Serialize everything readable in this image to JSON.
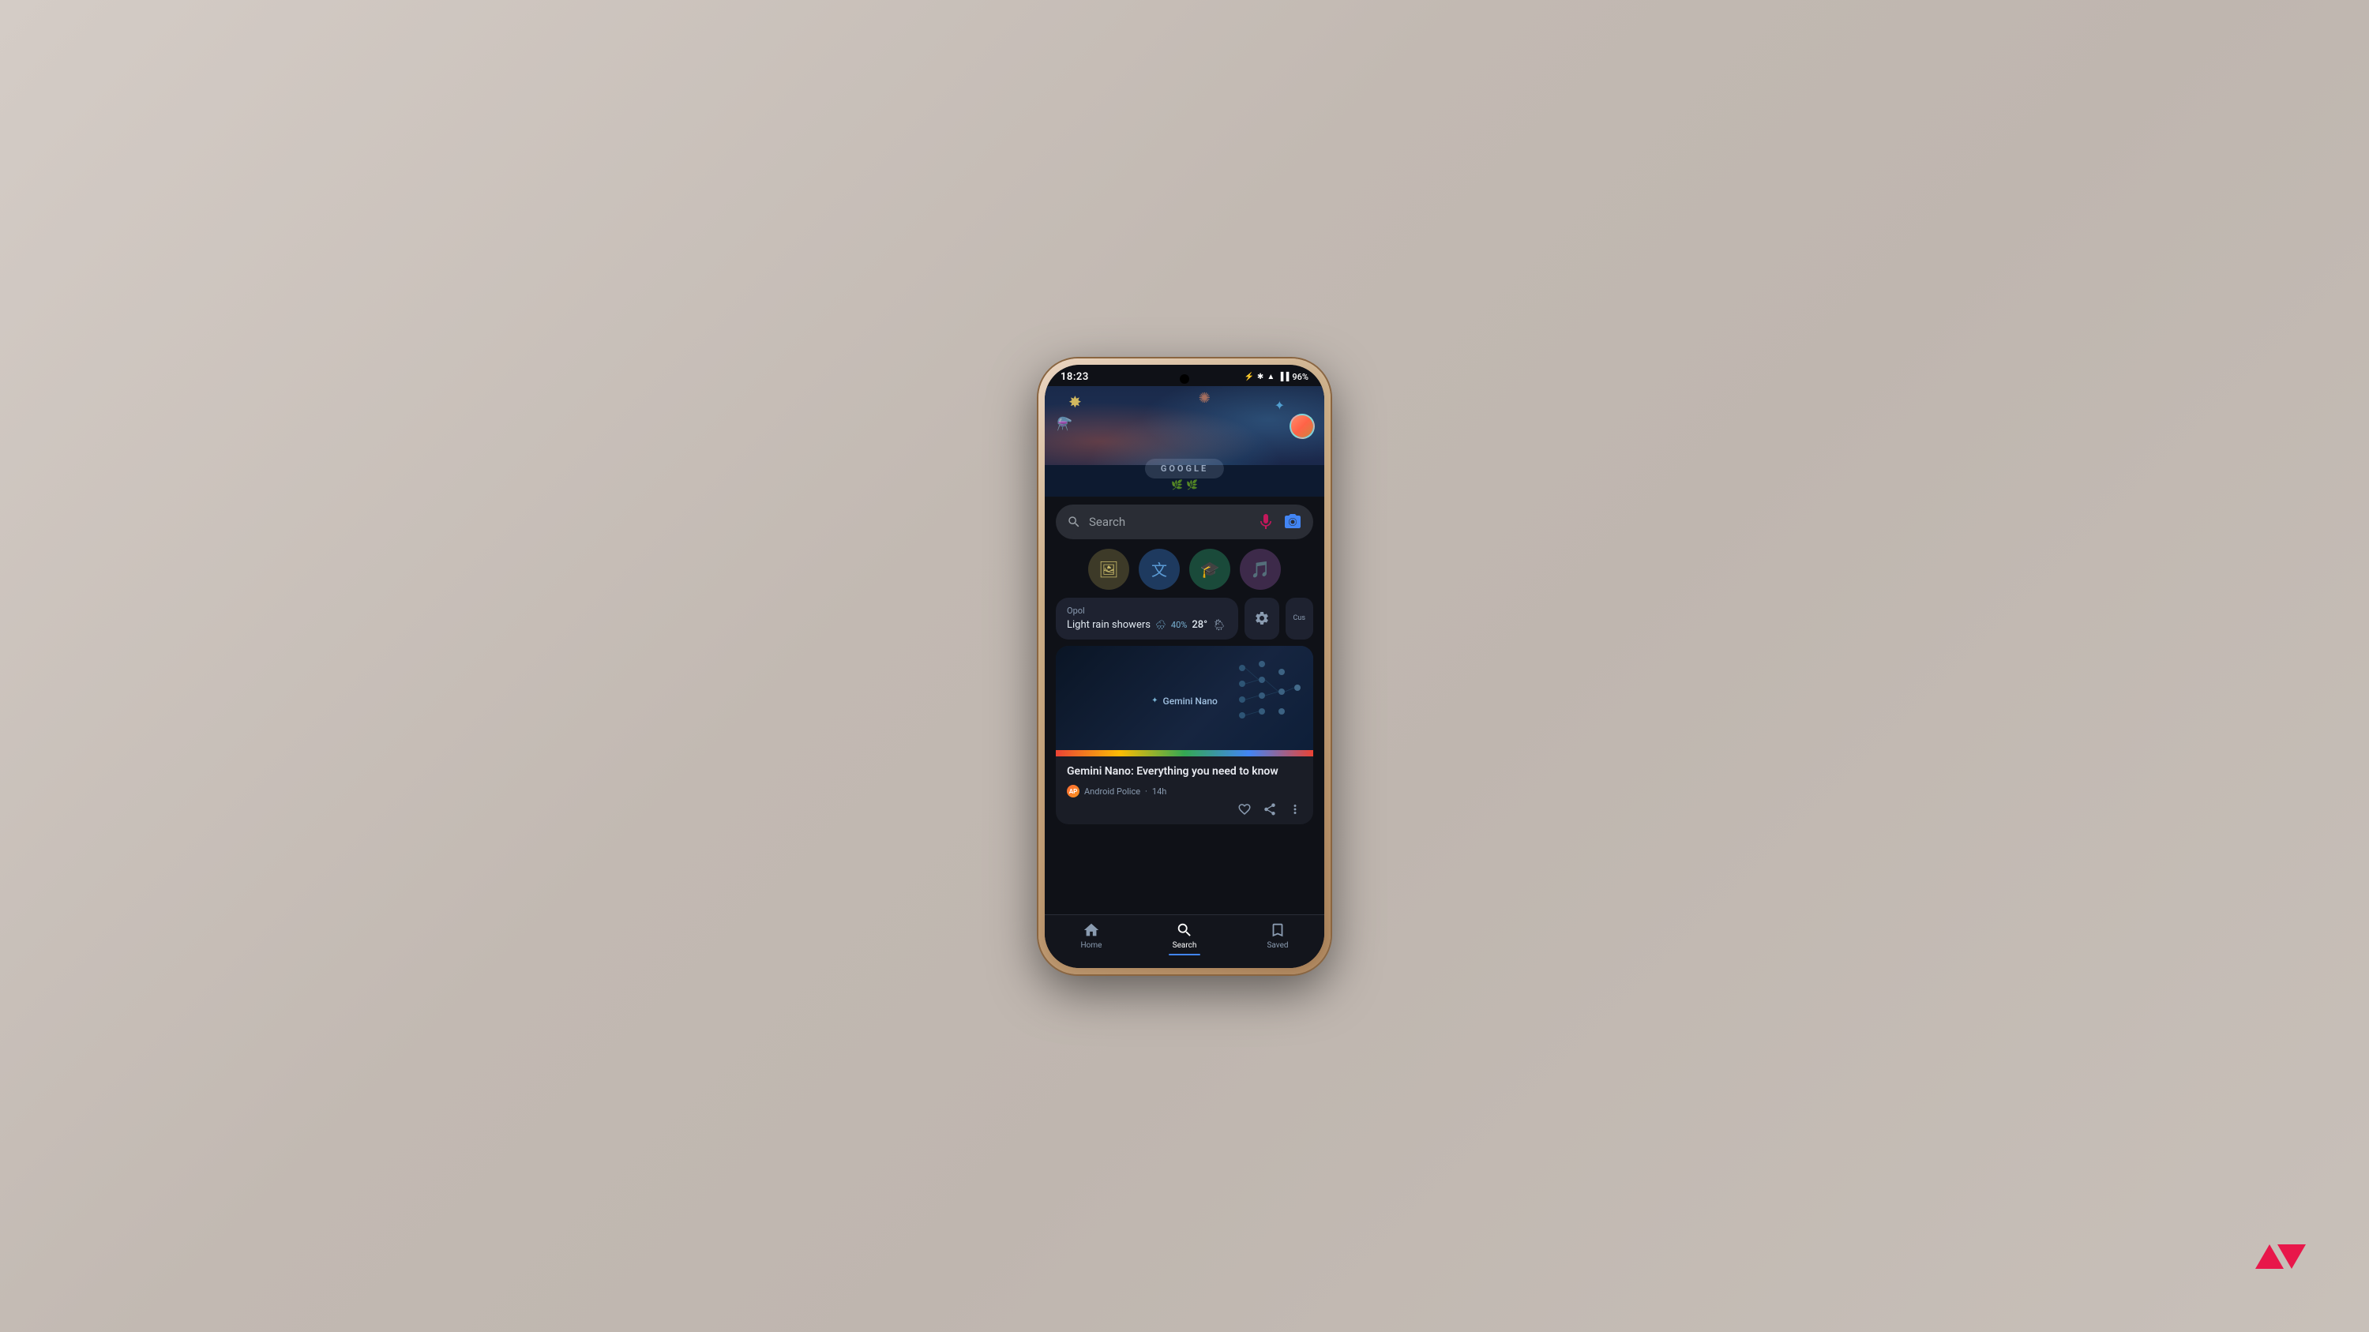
{
  "scene": {
    "bg_color": "#c2b8b0"
  },
  "status_bar": {
    "time": "18:23",
    "battery": "96%",
    "signal_icon": "signal",
    "wifi_icon": "wifi",
    "battery_icon": "battery"
  },
  "doodle": {
    "logo_text": "GOOGLE",
    "bg_label": "google-doodle-banner"
  },
  "search": {
    "placeholder": "Search",
    "mic_icon": "microphone-icon",
    "lens_icon": "camera-lens-icon",
    "search_icon": "search-icon"
  },
  "quick_actions": [
    {
      "id": "qa1",
      "icon": "🖼",
      "label": "image-search-button",
      "color": "#3d3a28"
    },
    {
      "id": "qa2",
      "icon": "文",
      "label": "translate-button",
      "color": "#1e3a5f"
    },
    {
      "id": "qa3",
      "icon": "🎓",
      "label": "school-button",
      "color": "#1a4a3a"
    },
    {
      "id": "qa4",
      "icon": "🎵",
      "label": "music-button",
      "color": "#3d2a4a"
    }
  ],
  "weather": {
    "location": "Opol",
    "condition": "Light rain showers",
    "rain_percent": "40%",
    "temperature": "28°",
    "settings_icon": "gear-icon",
    "cust_label": "Cus"
  },
  "news_card": {
    "thumbnail_label": "Gemini Nano",
    "title": "Gemini Nano: Everything you need to know",
    "source": "Android Police",
    "source_icon": "AP",
    "time": "14h",
    "like_icon": "heart-icon",
    "share_icon": "share-icon",
    "more_icon": "more-options-icon"
  },
  "bottom_nav": {
    "items": [
      {
        "id": "nav-home",
        "icon": "🏠",
        "label": "Home",
        "active": false
      },
      {
        "id": "nav-search",
        "icon": "🔍",
        "label": "Search",
        "active": true
      },
      {
        "id": "nav-saved",
        "icon": "🔖",
        "label": "Saved",
        "active": false
      }
    ]
  },
  "ap_logo": {
    "label": "Android Police Logo"
  }
}
